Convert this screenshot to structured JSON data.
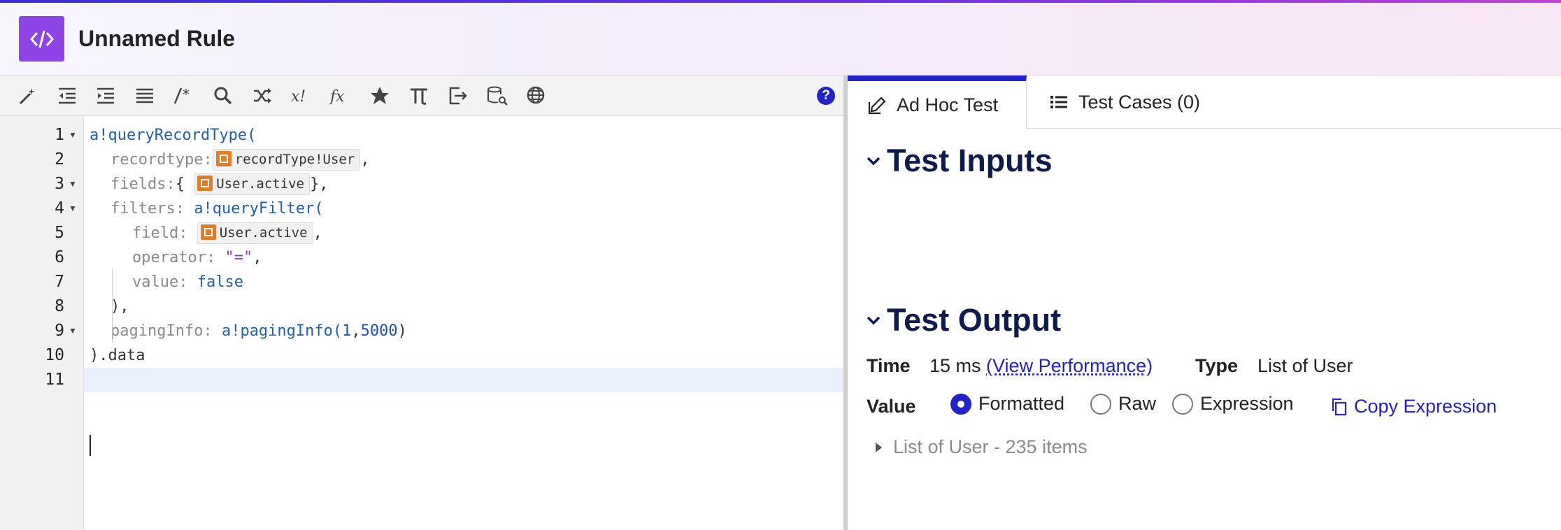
{
  "app": {
    "title": "Unnamed Rule",
    "logo_icon": "code-brackets-icon"
  },
  "toolbar": {
    "buttons": [
      {
        "icon": "magic-wand-icon"
      },
      {
        "icon": "outdent-icon"
      },
      {
        "icon": "indent-icon"
      },
      {
        "icon": "list-icon"
      },
      {
        "icon": "comment-icon"
      },
      {
        "icon": "search-icon"
      },
      {
        "icon": "shuffle-icon"
      },
      {
        "icon": "variable-icon"
      },
      {
        "icon": "function-icon"
      },
      {
        "icon": "star-icon"
      },
      {
        "icon": "pi-icon"
      },
      {
        "icon": "export-icon"
      },
      {
        "icon": "database-search-icon"
      },
      {
        "icon": "globe-icon"
      }
    ],
    "help_label": "?"
  },
  "editor": {
    "line_numbers": [
      "1",
      "2",
      "3",
      "4",
      "5",
      "6",
      "7",
      "8",
      "9",
      "10",
      "11"
    ],
    "lines": {
      "l1": "a!queryRecordType(",
      "l2_param": "recordtype:",
      "l2_chip": "recordType!User",
      "l3_param": "fields:",
      "l3_chip": "User.active",
      "l4_param": "filters:",
      "l4_fn": "a!queryFilter(",
      "l5_param": "field:",
      "l5_chip": "User.active",
      "l6_param": "operator:",
      "l6_str": "\"=\"",
      "l7_param": "value:",
      "l7_val": "false",
      "l8": "),",
      "l9_param": "pagingInfo:",
      "l9_fn": "a!pagingInfo(",
      "l9_a": "1",
      "l9_b": "5000",
      "l10": ").data"
    }
  },
  "panel": {
    "tabs": [
      {
        "label": "Ad Hoc Test",
        "icon": "edit-icon",
        "active": true
      },
      {
        "label": "Test Cases (0)",
        "icon": "list-icon",
        "active": false
      }
    ],
    "inputs_title": "Test Inputs",
    "output_title": "Test Output",
    "time_label": "Time",
    "time_value": "15 ms",
    "view_performance": "(View Performance)",
    "type_label": "Type",
    "type_value": "List of User",
    "value_label": "Value",
    "formats": [
      "Formatted",
      "Raw",
      "Expression"
    ],
    "selected_format": "Formatted",
    "copy_expression": "Copy Expression",
    "result_summary": "List of User - 235 items"
  },
  "colors": {
    "accent": "#2322c9",
    "logo": "#8e44e6",
    "keyword": "#1f5fb0",
    "chip": "#e57c23"
  }
}
